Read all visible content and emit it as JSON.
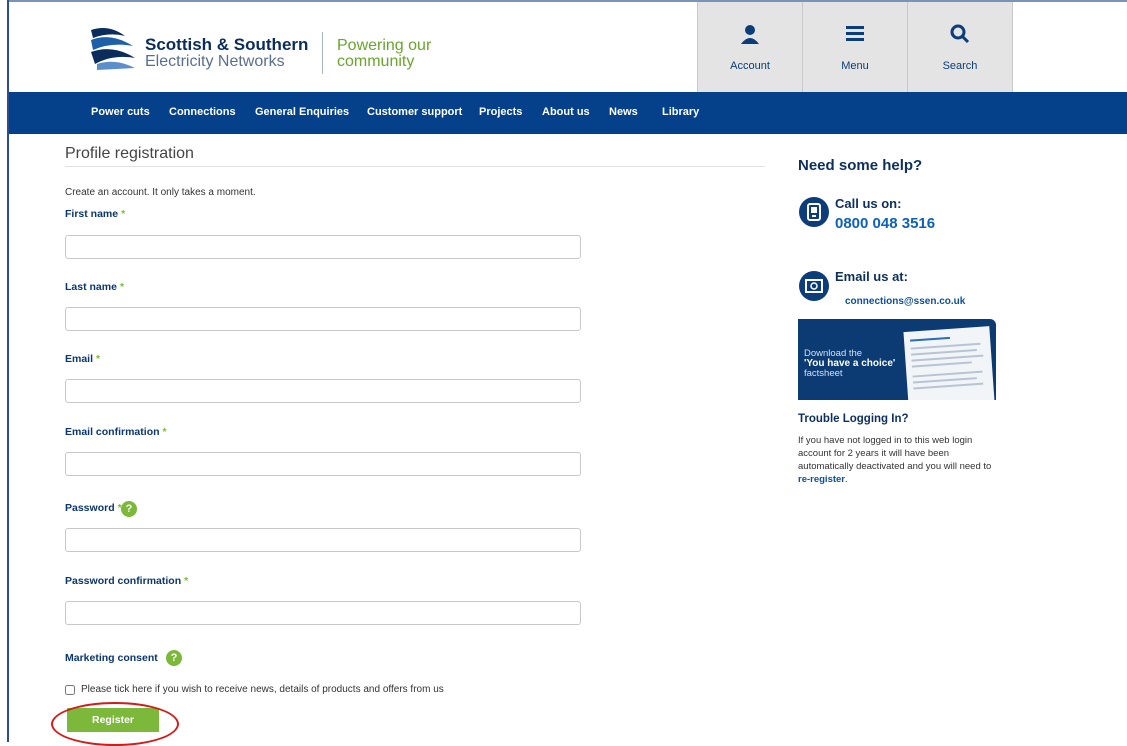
{
  "header": {
    "brand_line1": "Scottish & Southern",
    "brand_line2": "Electricity Networks",
    "tagline_line1": "Powering our",
    "tagline_line2": "community",
    "tiles": [
      {
        "label": "Account",
        "icon": "person-icon"
      },
      {
        "label": "Menu",
        "icon": "hamburger-icon"
      },
      {
        "label": "Search",
        "icon": "search-icon"
      }
    ]
  },
  "nav": {
    "items": [
      "Power cuts",
      "Connections",
      "General Enquiries",
      "Customer support",
      "Projects",
      "About us",
      "News",
      "Library"
    ]
  },
  "form": {
    "title": "Profile registration",
    "intro": "Create an account. It only takes a moment.",
    "required_mark": "*",
    "help_glyph": "?",
    "fields": {
      "first_name": "First name",
      "last_name": "Last name",
      "email": "Email",
      "email_confirmation": "Email confirmation",
      "password": "Password",
      "password_confirmation": "Password confirmation"
    },
    "marketing_label": "Marketing consent",
    "consent_text": "Please tick here if you wish to receive news, details of products and offers from us",
    "consent_checked": false,
    "register_label": "Register"
  },
  "sidebar": {
    "help_title": "Need some help?",
    "call_label": "Call us on:",
    "phone": "0800 048 3516",
    "email_label": "Email us at:",
    "email": "connections@ssen.co.uk",
    "banner": {
      "line1": "Download the",
      "line2": "'You have a choice'",
      "line3": "factsheet"
    },
    "trouble_title": "Trouble Logging In?",
    "trouble_text": "If you have not logged in to this web login account for 2 years it will have been automatically deactivated and you will need to",
    "trouble_link": "re-register",
    "trouble_end": "."
  },
  "colors": {
    "nav_bg": "#04418a",
    "brand_navy": "#0a2d5c",
    "accent_green": "#7cb83a",
    "highlight_red": "#d21c1c"
  }
}
